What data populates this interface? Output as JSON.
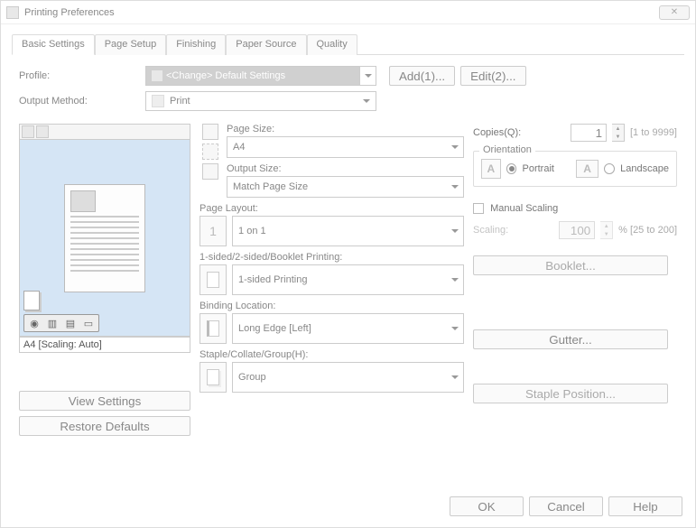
{
  "window": {
    "title": "Printing Preferences"
  },
  "tabs": {
    "basic": "Basic Settings",
    "page_setup": "Page Setup",
    "finishing": "Finishing",
    "paper_source": "Paper Source",
    "quality": "Quality"
  },
  "profile": {
    "label": "Profile:",
    "value": "<Change> Default Settings",
    "add_btn": "Add(1)...",
    "edit_btn": "Edit(2)..."
  },
  "output_method": {
    "label": "Output Method:",
    "value": "Print"
  },
  "preview": {
    "status": "A4 [Scaling: Auto]",
    "view_settings_btn": "View Settings",
    "restore_defaults_btn": "Restore Defaults"
  },
  "page_size": {
    "label": "Page Size:",
    "value": "A4"
  },
  "output_size": {
    "label": "Output Size:",
    "value": "Match Page Size"
  },
  "page_layout": {
    "label": "Page Layout:",
    "value": "1 on 1",
    "icon_text": "1"
  },
  "printing_sides": {
    "label": "1-sided/2-sided/Booklet Printing:",
    "value": "1-sided Printing"
  },
  "binding": {
    "label": "Binding Location:",
    "value": "Long Edge [Left]"
  },
  "staple": {
    "label": "Staple/Collate/Group(H):",
    "value": "Group"
  },
  "copies": {
    "label": "Copies(Q):",
    "value": "1",
    "range": "[1 to 9999]"
  },
  "orientation": {
    "legend": "Orientation",
    "portrait": "Portrait",
    "landscape": "Landscape"
  },
  "manual_scaling": {
    "label": "Manual Scaling",
    "scaling_label": "Scaling:",
    "scaling_value": "100",
    "scaling_range": "% [25 to 200]"
  },
  "right_buttons": {
    "booklet": "Booklet...",
    "gutter": "Gutter...",
    "staple_position": "Staple Position..."
  },
  "footer": {
    "ok": "OK",
    "cancel": "Cancel",
    "help": "Help"
  }
}
